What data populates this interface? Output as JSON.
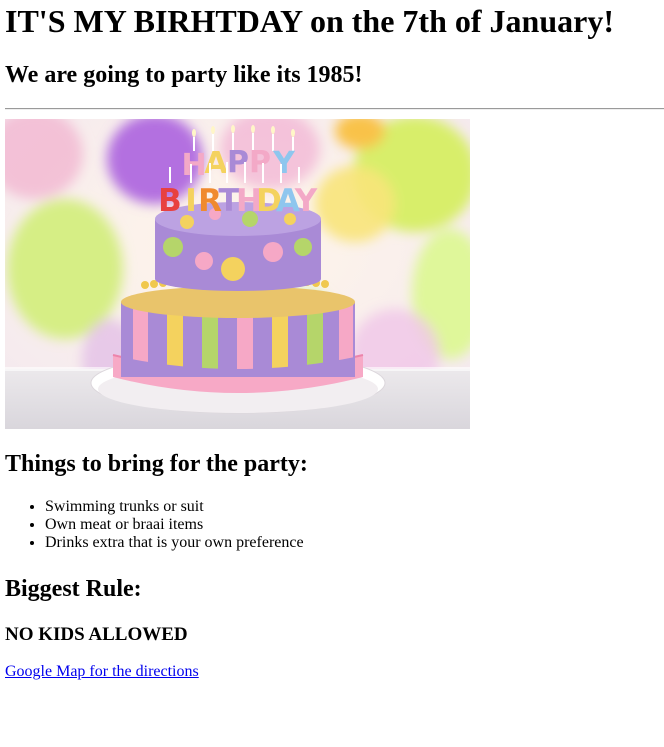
{
  "header": {
    "title": "IT'S MY BIRHTDAY on the 7th of January!",
    "subtitle": "We are going to party like its 1985!"
  },
  "image": {
    "candle_text": "HAPPY BIRTHDAY",
    "icon": "birthday-cake-photo"
  },
  "bring": {
    "heading": "Things to bring for the party:",
    "items": [
      "Swimming trunks or suit",
      "Own meat or braai items",
      "Drinks extra that is your own preference"
    ]
  },
  "rule": {
    "heading": "Biggest Rule:",
    "text": "NO KIDS ALLOWED"
  },
  "link": {
    "label": "Google Map for the directions"
  },
  "colors": {
    "link": "#0000ee",
    "cake_purple": "#a98ad6",
    "cake_pink": "#f3a9c7",
    "cake_yellow": "#f4d25e",
    "cake_green": "#b5d56a"
  }
}
